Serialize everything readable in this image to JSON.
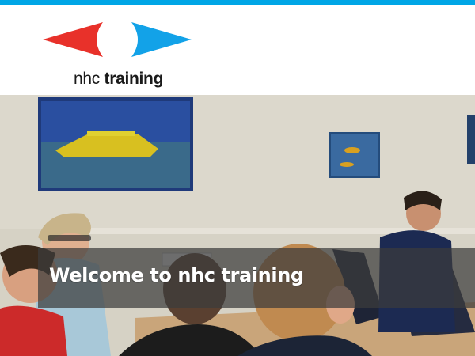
{
  "brand": {
    "name_regular": "nhc",
    "name_bold": "training",
    "colors": {
      "arrow_left": "#e8312a",
      "arrow_right": "#12a2e8",
      "top_bar": "#00a6e6"
    }
  },
  "hero": {
    "image_alt_icon": "classroom-photo",
    "welcome_title": "Welcome to nhc training"
  }
}
